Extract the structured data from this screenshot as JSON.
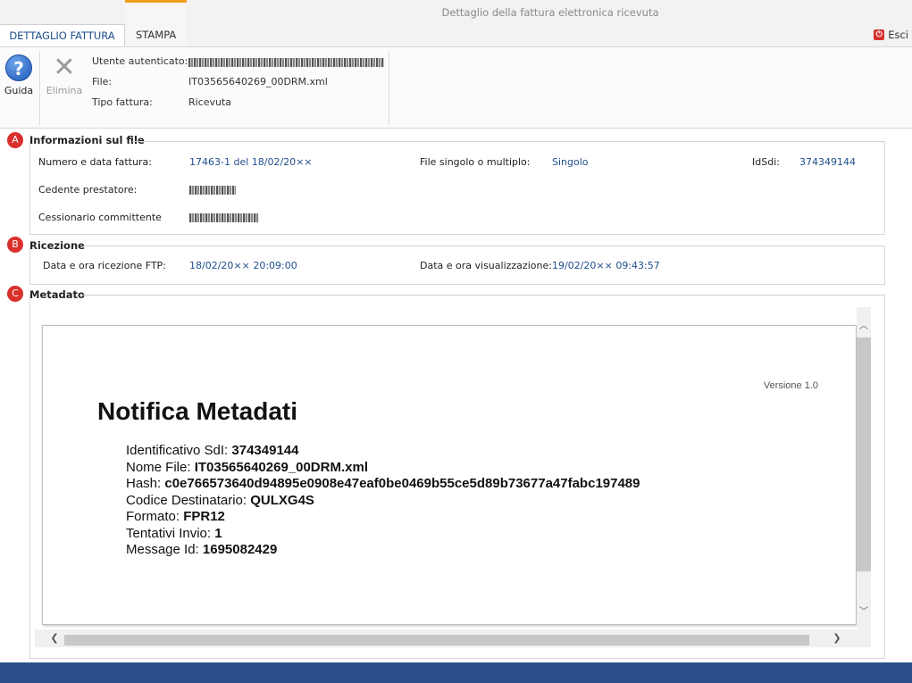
{
  "window": {
    "title": "Dettaglio della fattura elettronica ricevuta"
  },
  "tabs": [
    {
      "label": "DETTAGLIO FATTURA"
    },
    {
      "label": "STAMPA"
    }
  ],
  "exit": {
    "label": "Esci"
  },
  "ribbon": {
    "guida": {
      "label": "Guida",
      "icon": "?"
    },
    "elimina": {
      "label": "Elimina",
      "icon": "✕"
    },
    "fields": {
      "utente_label": "Utente autenticato:",
      "file_label": "File:",
      "file_value": "IT03565640269_00DRM.xml",
      "tipo_label": "Tipo fattura:",
      "tipo_value": "Ricevuta"
    }
  },
  "sections": {
    "a": {
      "badge": "A",
      "title": "Informazioni sul file",
      "numero_label": "Numero e data fattura:",
      "numero_value": "17463-1 del 18/02/20××",
      "singolo_label": "File singolo o multiplo:",
      "singolo_value": "Singolo",
      "idsdi_label": "IdSdi:",
      "idsdi_value": "374349144",
      "cedente_label": "Cedente prestatore:",
      "cessionario_label": "Cessionario committente"
    },
    "b": {
      "badge": "B",
      "title": "Ricezione",
      "ftp_label": "Data e ora ricezione FTP:",
      "ftp_value": "18/02/20×× 20:09:00",
      "vis_label": "Data e ora visualizzazione:",
      "vis_value": "19/02/20×× 09:43:57"
    },
    "c": {
      "badge": "C",
      "title": "Metadato"
    }
  },
  "document": {
    "version": "Versione 1.0",
    "title": "Notifica Metadati",
    "rows": [
      {
        "label": "Identificativo SdI: ",
        "value": "374349144"
      },
      {
        "label": "Nome File: ",
        "value": "IT03565640269_00DRM.xml"
      },
      {
        "label": "Hash: ",
        "value": "c0e766573640d94895e0908e47eaf0be0469b55ce5d89b73677a47fabc197489"
      },
      {
        "label": "Codice Destinatario: ",
        "value": "QULXG4S"
      },
      {
        "label": "Formato: ",
        "value": "FPR12"
      },
      {
        "label": "Tentativi Invio: ",
        "value": "1"
      },
      {
        "label": "Message Id: ",
        "value": "1695082429"
      }
    ]
  },
  "colors": {
    "accent_blue": "#1f4e8c",
    "badge_red": "#d9302c",
    "tab_orange": "#f0a020",
    "footer_blue": "#2a4f8c"
  }
}
